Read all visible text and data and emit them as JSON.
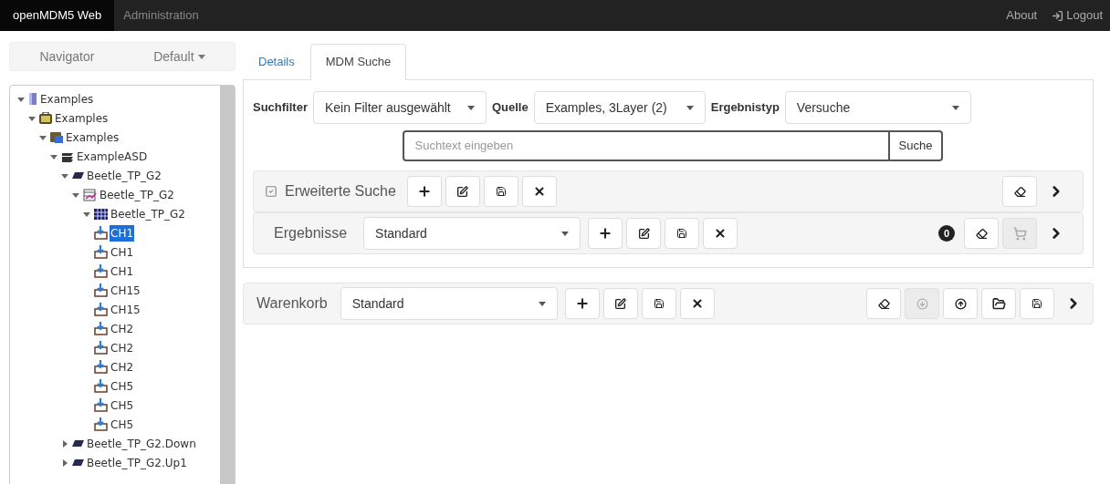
{
  "navbar": {
    "brand": "openMDM5 Web",
    "links": [
      {
        "label": "Administration",
        "selected": false
      }
    ],
    "right": [
      {
        "label": "About",
        "kind": "text"
      },
      {
        "label": "Logout",
        "kind": "logout"
      }
    ]
  },
  "navigator": {
    "title": "Navigator",
    "view": "Default"
  },
  "tree": [
    {
      "label": "Examples",
      "kind": "source",
      "expanded": true,
      "selected": false,
      "children": [
        {
          "label": "Examples",
          "kind": "project",
          "expanded": true,
          "selected": false,
          "children": [
            {
              "label": "Examples",
              "kind": "pool",
              "expanded": true,
              "selected": false,
              "children": [
                {
                  "label": "ExampleASD",
                  "kind": "test",
                  "expanded": true,
                  "selected": false,
                  "children": [
                    {
                      "label": "Beetle_TP_G2",
                      "kind": "teststep",
                      "expanded": true,
                      "selected": false,
                      "children": [
                        {
                          "label": "Beetle_TP_G2",
                          "kind": "measurement",
                          "expanded": true,
                          "selected": false,
                          "children": [
                            {
                              "label": "Beetle_TP_G2",
                              "kind": "channelgroup",
                              "expanded": true,
                              "selected": false,
                              "children": [
                                {
                                  "label": "CH1",
                                  "kind": "channel",
                                  "selected": true
                                },
                                {
                                  "label": "CH1",
                                  "kind": "channel",
                                  "selected": false
                                },
                                {
                                  "label": "CH1",
                                  "kind": "channel",
                                  "selected": false
                                },
                                {
                                  "label": "CH15",
                                  "kind": "channel",
                                  "selected": false
                                },
                                {
                                  "label": "CH15",
                                  "kind": "channel",
                                  "selected": false
                                },
                                {
                                  "label": "CH2",
                                  "kind": "channel",
                                  "selected": false
                                },
                                {
                                  "label": "CH2",
                                  "kind": "channel",
                                  "selected": false
                                },
                                {
                                  "label": "CH2",
                                  "kind": "channel",
                                  "selected": false
                                },
                                {
                                  "label": "CH5",
                                  "kind": "channel",
                                  "selected": false
                                },
                                {
                                  "label": "CH5",
                                  "kind": "channel",
                                  "selected": false
                                },
                                {
                                  "label": "CH5",
                                  "kind": "channel",
                                  "selected": false
                                }
                              ]
                            }
                          ]
                        }
                      ]
                    },
                    {
                      "label": "Beetle_TP_G2.Down",
                      "kind": "teststep",
                      "expanded": false,
                      "selected": false
                    },
                    {
                      "label": "Beetle_TP_G2.Up1",
                      "kind": "teststep",
                      "expanded": false,
                      "selected": false
                    }
                  ]
                }
              ]
            }
          ]
        }
      ]
    }
  ],
  "tabs": [
    {
      "label": "Details",
      "selected": false
    },
    {
      "label": "MDM Suche",
      "selected": true
    }
  ],
  "filters": [
    {
      "label": "Suchfilter",
      "value": "Kein Filter ausgewählt"
    },
    {
      "label": "Quelle",
      "value": "Examples, 3Layer (2)"
    },
    {
      "label": "Ergebnistyp",
      "value": "Versuche"
    }
  ],
  "search": {
    "placeholder": "Suchtext eingeben",
    "button": "Suche"
  },
  "advanced": {
    "label": "Erweiterte Suche",
    "checked": true,
    "buttons": [
      {
        "kind": "add",
        "disabled": false
      },
      {
        "kind": "edit",
        "disabled": false
      },
      {
        "kind": "save",
        "disabled": false
      },
      {
        "kind": "delete",
        "disabled": false
      }
    ],
    "right_buttons": [
      {
        "kind": "clear",
        "disabled": false
      }
    ]
  },
  "results": {
    "label": "Ergebnisse",
    "view": "Standard",
    "buttons": [
      {
        "kind": "add",
        "disabled": false
      },
      {
        "kind": "edit",
        "disabled": false
      },
      {
        "kind": "save",
        "disabled": false
      },
      {
        "kind": "delete",
        "disabled": false
      }
    ],
    "count": "0",
    "right_buttons": [
      {
        "kind": "clear",
        "disabled": false
      },
      {
        "kind": "cart",
        "disabled": true
      }
    ]
  },
  "basket": {
    "label": "Warenkorb",
    "view": "Standard",
    "buttons": [
      {
        "kind": "add",
        "disabled": false
      },
      {
        "kind": "edit",
        "disabled": false
      },
      {
        "kind": "save",
        "disabled": false
      },
      {
        "kind": "delete",
        "disabled": false
      }
    ],
    "right_buttons": [
      {
        "kind": "clear",
        "disabled": false
      },
      {
        "kind": "download",
        "disabled": true
      },
      {
        "kind": "upload",
        "disabled": false
      },
      {
        "kind": "open",
        "disabled": false
      },
      {
        "kind": "save",
        "disabled": false
      }
    ]
  }
}
